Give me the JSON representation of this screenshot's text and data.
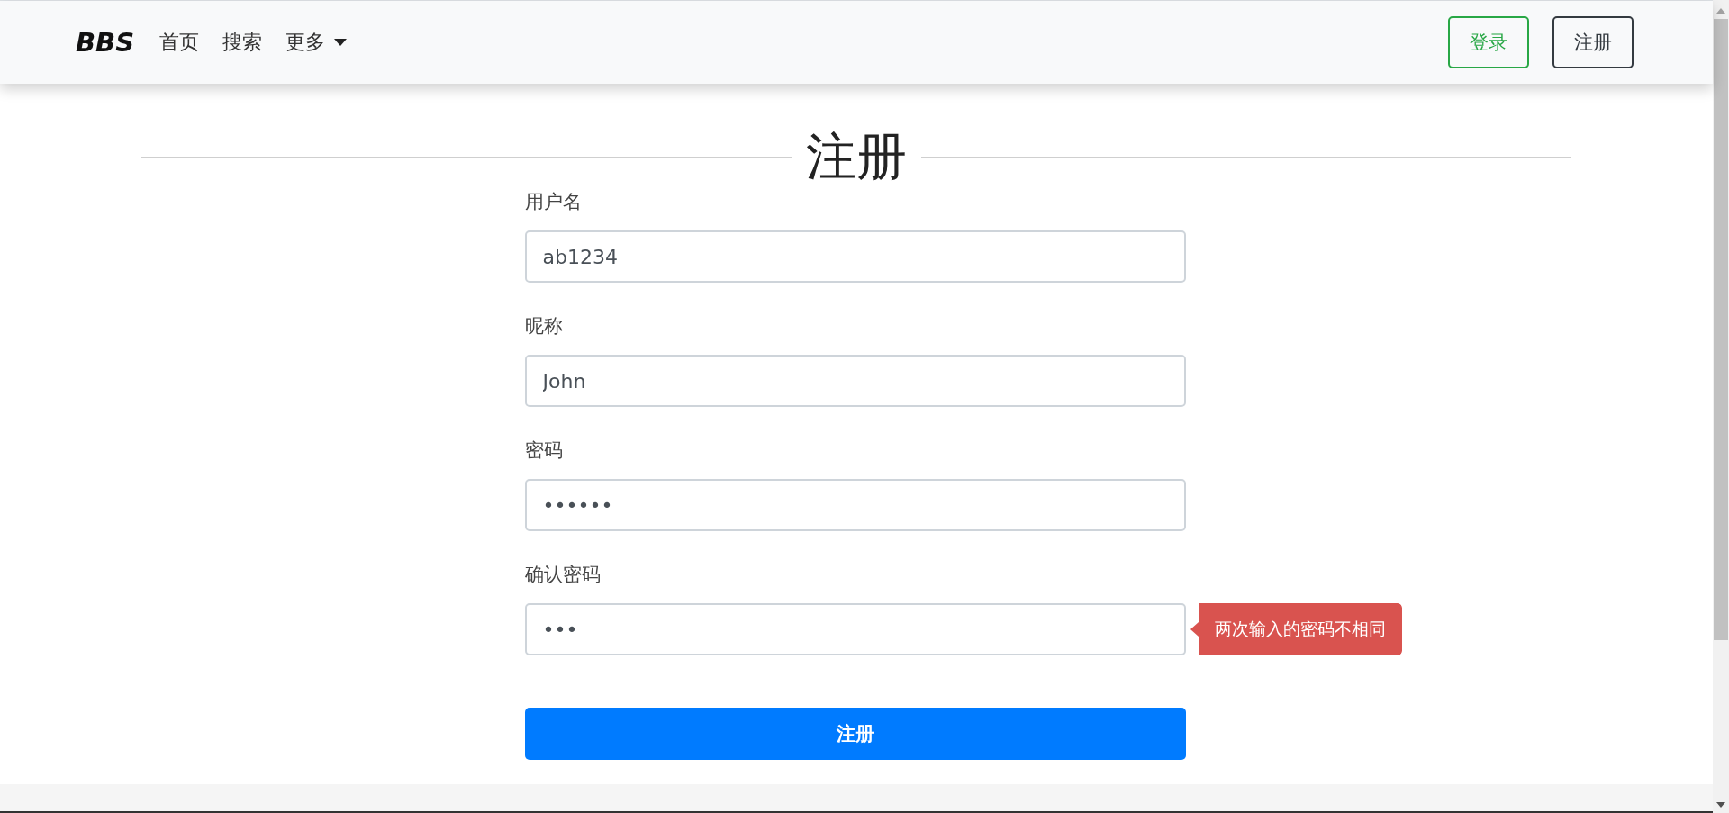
{
  "navbar": {
    "brand": "BBS",
    "links": [
      {
        "label": "首页",
        "kind": "link"
      },
      {
        "label": "搜索",
        "kind": "link"
      },
      {
        "label": "更多",
        "kind": "dropdown"
      }
    ],
    "buttons": [
      {
        "label": "登录",
        "kind": "success"
      },
      {
        "label": "注册",
        "kind": "dark"
      }
    ]
  },
  "heading": "注册",
  "fields": [
    {
      "label": "用户名",
      "value": "ab1234"
    },
    {
      "label": "昵称",
      "value": "John"
    },
    {
      "label": "密码",
      "value": "••••••"
    },
    {
      "label": "确认密码",
      "value": "•••",
      "error": "两次输入的密码不相同"
    }
  ],
  "submit": "注册"
}
